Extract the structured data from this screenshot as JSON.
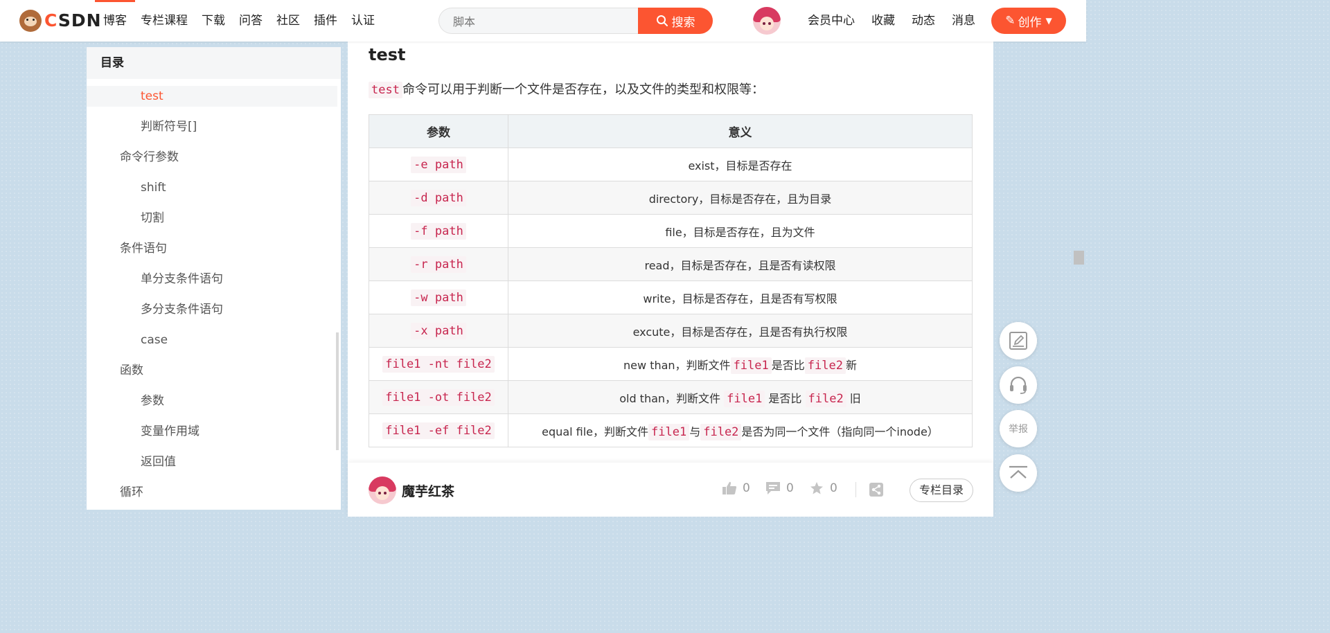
{
  "header": {
    "logo_text": "CSDN",
    "nav": [
      "博客",
      "专栏课程",
      "下载",
      "问答",
      "社区",
      "插件",
      "认证"
    ],
    "search": {
      "placeholder": "脚本",
      "button_label": "搜索"
    },
    "links": [
      "会员中心",
      "收藏",
      "动态",
      "消息"
    ],
    "create_label": "创作",
    "accent_color": "#fc5531"
  },
  "toc": {
    "title": "目录",
    "items": [
      {
        "label": "test",
        "level": 3,
        "active": true
      },
      {
        "label": "判断符号[]",
        "level": 3
      },
      {
        "label": "命令行参数",
        "level": 2
      },
      {
        "label": "shift",
        "level": 3
      },
      {
        "label": "切割",
        "level": 3
      },
      {
        "label": "条件语句",
        "level": 2
      },
      {
        "label": "单分支条件语句",
        "level": 3
      },
      {
        "label": "多分支条件语句",
        "level": 3
      },
      {
        "label": "case",
        "level": 3
      },
      {
        "label": "函数",
        "level": 2
      },
      {
        "label": "参数",
        "level": 3
      },
      {
        "label": "变量作用域",
        "level": 3
      },
      {
        "label": "返回值",
        "level": 3
      },
      {
        "label": "循环",
        "level": 2
      }
    ]
  },
  "article": {
    "heading": "test",
    "intro_code": "test",
    "intro_text": "命令可以用于判断一个文件是否存在，以及文件的类型和权限等：",
    "table": {
      "headers": [
        "参数",
        "意义"
      ],
      "rows": [
        {
          "param": "-e path",
          "meaning": [
            {
              "t": "exist，目标是否存在"
            }
          ]
        },
        {
          "param": "-d path",
          "meaning": [
            {
              "t": "directory，目标是否存在，且为目录"
            }
          ]
        },
        {
          "param": "-f path",
          "meaning": [
            {
              "t": "file，目标是否存在，且为文件"
            }
          ]
        },
        {
          "param": "-r path",
          "meaning": [
            {
              "t": "read，目标是否存在，且是否有读权限"
            }
          ]
        },
        {
          "param": "-w path",
          "meaning": [
            {
              "t": "write，目标是否存在，且是否有写权限"
            }
          ]
        },
        {
          "param": "-x path",
          "meaning": [
            {
              "t": "excute，目标是否存在，且是否有执行权限"
            }
          ]
        },
        {
          "param": "file1 -nt file2",
          "meaning": [
            {
              "t": "new than，判断文件"
            },
            {
              "c": "file1"
            },
            {
              "t": "是否比"
            },
            {
              "c": "file2"
            },
            {
              "t": "新"
            }
          ]
        },
        {
          "param": "file1 -ot file2",
          "meaning": [
            {
              "t": "old than，判断文件 "
            },
            {
              "c": "file1"
            },
            {
              "t": " 是否比 "
            },
            {
              "c": "file2"
            },
            {
              "t": " 旧"
            }
          ]
        },
        {
          "param": "file1 -ef file2",
          "meaning": [
            {
              "t": "equal file，判断文件"
            },
            {
              "c": "file1"
            },
            {
              "t": "与"
            },
            {
              "c": "file2"
            },
            {
              "t": "是否为同一个文件（指向同一个inode）"
            }
          ]
        }
      ]
    }
  },
  "bottom_bar": {
    "author": "魔芋红茶",
    "likes": "0",
    "comments": "0",
    "favorites": "0",
    "column_label": "专栏目录"
  },
  "float_tools": {
    "report_label": "举报"
  }
}
